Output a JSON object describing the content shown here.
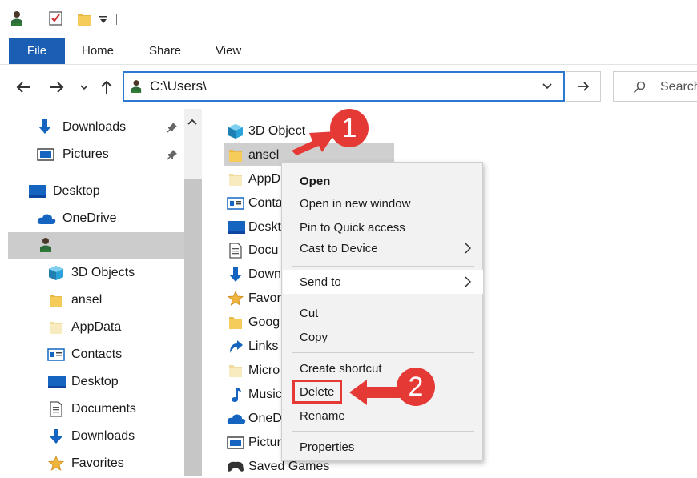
{
  "titlebar": {
    "icons": [
      "user-folder-icon",
      "properties-checkbox-icon",
      "new-folder-icon",
      "quick-access-dropdown-icon"
    ]
  },
  "ribbon": {
    "tabs": [
      "File",
      "Home",
      "Share",
      "View"
    ]
  },
  "navbar": {
    "address": "C:\\Users\\",
    "search_placeholder": "Search"
  },
  "nav_pane": {
    "items": [
      {
        "label": "Downloads",
        "icon": "download-arrow-icon",
        "pinned": true
      },
      {
        "label": "Pictures",
        "icon": "pictures-icon",
        "pinned": true
      },
      {
        "label": "Desktop",
        "icon": "desktop-icon"
      },
      {
        "label": "OneDrive",
        "icon": "onedrive-cloud-icon"
      },
      {
        "label": "",
        "icon": "user-folder-icon",
        "selected": true
      },
      {
        "label": "3D Objects",
        "icon": "3d-objects-icon"
      },
      {
        "label": "ansel",
        "icon": "folder-icon"
      },
      {
        "label": "AppData",
        "icon": "folder-faded-icon"
      },
      {
        "label": "Contacts",
        "icon": "contacts-icon"
      },
      {
        "label": "Desktop",
        "icon": "desktop-icon"
      },
      {
        "label": "Documents",
        "icon": "documents-icon"
      },
      {
        "label": "Downloads",
        "icon": "download-arrow-icon"
      },
      {
        "label": "Favorites",
        "icon": "star-icon"
      }
    ]
  },
  "content": {
    "items": [
      {
        "label": "3D Object",
        "icon": "3d-objects-icon"
      },
      {
        "label": "ansel",
        "icon": "folder-icon",
        "selected": true
      },
      {
        "label": "AppD",
        "icon": "folder-faded-icon"
      },
      {
        "label": "Conta",
        "icon": "contacts-icon"
      },
      {
        "label": "Deskt",
        "icon": "desktop-icon"
      },
      {
        "label": "Docu",
        "icon": "documents-icon"
      },
      {
        "label": "Down",
        "icon": "download-arrow-icon"
      },
      {
        "label": "Favor",
        "icon": "star-icon"
      },
      {
        "label": "Goog",
        "icon": "folder-icon"
      },
      {
        "label": "Links",
        "icon": "link-arrow-icon"
      },
      {
        "label": "Micro",
        "icon": "folder-faded-icon"
      },
      {
        "label": "Music",
        "icon": "music-note-icon"
      },
      {
        "label": "OneD",
        "icon": "onedrive-cloud-icon"
      },
      {
        "label": "Pictur",
        "icon": "pictures-icon"
      },
      {
        "label": "Saved Games",
        "icon": "saved-games-icon"
      }
    ]
  },
  "context_menu": {
    "items": [
      {
        "label": "Open",
        "bold": true
      },
      {
        "label": "Open in new window"
      },
      {
        "label": "Pin to Quick access"
      },
      {
        "label": "Cast to Device",
        "submenu": true
      },
      {
        "label": "Send to",
        "submenu": true,
        "highlighted": true
      },
      {
        "label": "Cut"
      },
      {
        "label": "Copy"
      },
      {
        "label": "Create shortcut"
      },
      {
        "label": "Delete",
        "annotated": true
      },
      {
        "label": "Rename"
      },
      {
        "label": "Properties"
      }
    ]
  },
  "callouts": [
    {
      "number": "1",
      "target": "ansel"
    },
    {
      "number": "2",
      "target": "Delete"
    }
  ],
  "colors": {
    "file_tab": "#1a5fb4",
    "address_border": "#2b79d0",
    "callout_red": "#e53935",
    "selection_gray": "#cccccc",
    "menu_bg": "#f2f2f2"
  }
}
